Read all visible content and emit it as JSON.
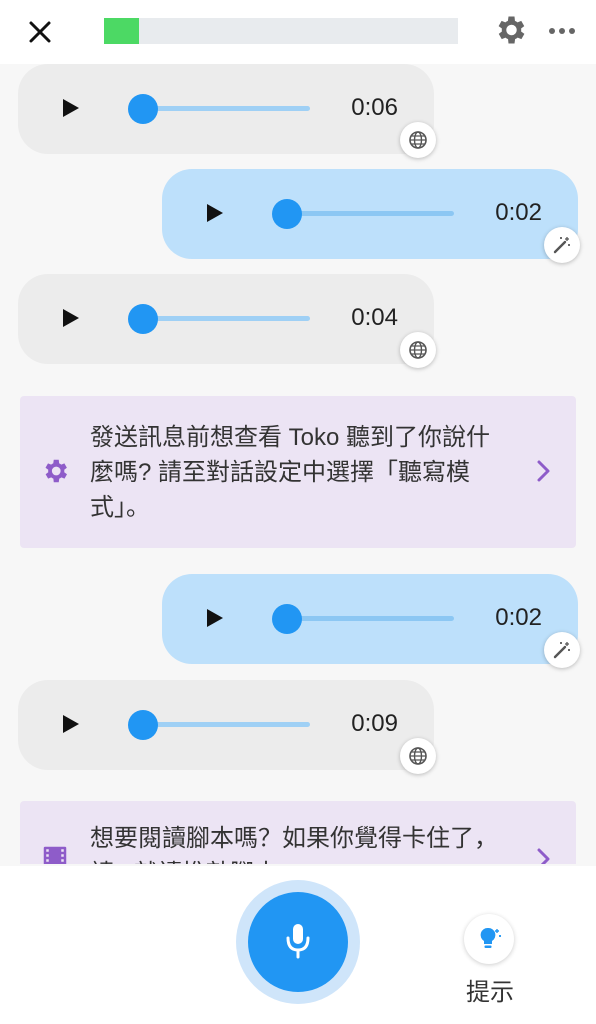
{
  "header": {
    "close_icon": "close-icon",
    "progress_fraction": 0.1,
    "progress_color": "#4cd964",
    "settings_icon": "gear-icon",
    "more_icon": "more-horizontal-icon"
  },
  "messages": [
    {
      "sender": "bot",
      "duration": "0:06",
      "badge_icon": "globe-icon"
    },
    {
      "sender": "user",
      "duration": "0:02",
      "badge_icon": "magic-wand-icon"
    },
    {
      "sender": "bot",
      "duration": "0:04",
      "badge_icon": "globe-icon"
    },
    {
      "sender": "user",
      "duration": "0:02",
      "badge_icon": "magic-wand-icon"
    },
    {
      "sender": "bot",
      "duration": "0:09",
      "badge_icon": "globe-icon"
    }
  ],
  "tips": [
    {
      "icon": "gear-icon",
      "lines": [
        "發送訊息前想查看 Toko 聽到了你說什",
        "麼嗎? 請至對話設定中選擇「聽寫模",
        "式」。"
      ]
    },
    {
      "icon": "film-icon",
      "lines": [
        "想要閱讀腳本嗎？如果你覺得卡住了，",
        "請...就讀推敲腳本"
      ]
    }
  ],
  "bottom": {
    "mic_icon": "microphone-icon",
    "hint_icon": "lightbulb-icon",
    "hint_label": "提示"
  },
  "colors": {
    "accent": "#2196f3",
    "bot_bubble": "#ececec",
    "user_bubble": "#bde0fb",
    "tip_bg": "#ece4f4",
    "tip_icon": "#8e5cc9"
  }
}
